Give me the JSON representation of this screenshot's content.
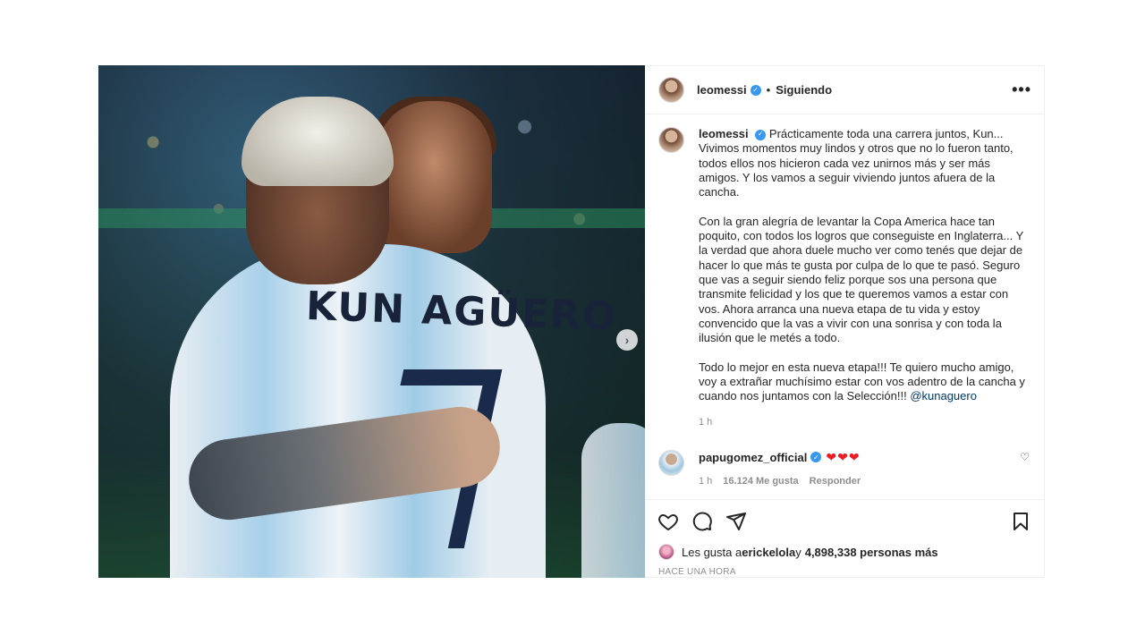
{
  "post": {
    "author": "leomessi",
    "follow_status": "Siguiendo",
    "separator": "•",
    "more_icon": "more-options-icon",
    "verified_icon": "verified-badge-icon",
    "image": {
      "jersey_text": "KUN AGÜERO",
      "next_icon": "chevron-right-icon"
    },
    "caption": {
      "username": "leomessi",
      "paragraphs": [
        "Prácticamente toda una carrera juntos, Kun... Vivimos momentos muy lindos y otros que no lo fueron tanto, todos ellos nos hicieron cada vez unirnos más y ser más amigos. Y los vamos a seguir viviendo juntos afuera de la cancha.",
        "Con la gran alegría de levantar la Copa America hace tan poquito, con todos los logros que conseguiste en Inglaterra... Y la verdad que ahora duele mucho ver como tenés que dejar de hacer lo que más te gusta por culpa de lo que te pasó. Seguro que vas a seguir siendo feliz porque sos una persona que transmite felicidad y los que te queremos vamos a estar con vos. Ahora arranca una nueva etapa de tu vida y estoy convencido que la vas a vivir con una sonrisa y con toda la ilusión que le metés a todo."
      ],
      "last_paragraph": "Todo lo mejor en esta nueva etapa!!! Te quiero mucho amigo, voy a extrañar muchísimo estar con vos adentro de la cancha y cuando nos juntamos con la Selección!!! ",
      "mention": "@kunaguero",
      "time": "1 h"
    },
    "comment": {
      "username": "papugomez_official",
      "hearts": "❤❤❤",
      "time": "1 h",
      "likes": "16.124 Me gusta",
      "reply": "Responder"
    },
    "actions": {
      "like_icon": "heart-icon",
      "comment_icon": "comment-icon",
      "share_icon": "share-icon",
      "save_icon": "bookmark-icon"
    },
    "likes": {
      "prefix": "Les gusta a ",
      "user": "erickelola",
      "middle": " y ",
      "count": "4,898,338 personas más"
    },
    "timestamp": "HACE UNA HORA",
    "colors": {
      "accent_blue": "#3897f0",
      "mention": "#00376b",
      "heart_red": "#ed1c24",
      "meta_gray": "#8e8e8e"
    }
  }
}
